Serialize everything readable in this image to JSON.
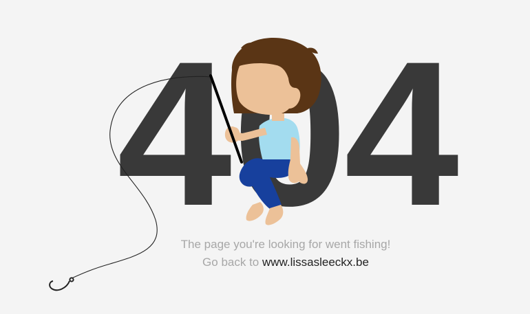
{
  "error": {
    "code_digits": [
      "4",
      "0",
      "4"
    ],
    "message": "The page you're looking for went fishing!",
    "back_prefix": "Go back to",
    "back_link_text": "www.lissasleeckx.be"
  },
  "colors": {
    "background": "#f4f4f4",
    "digits": "#393939",
    "message_text": "#a7a7a7",
    "link_text": "#222222",
    "hair": "#5a3515",
    "skin": "#ecc198",
    "shirt": "#a3dcef",
    "pants": "#17409d"
  },
  "illustration": {
    "figure": "boy-fishing",
    "props": [
      "fishing-rod-icon",
      "fishing-line",
      "fish-hook-icon"
    ]
  }
}
